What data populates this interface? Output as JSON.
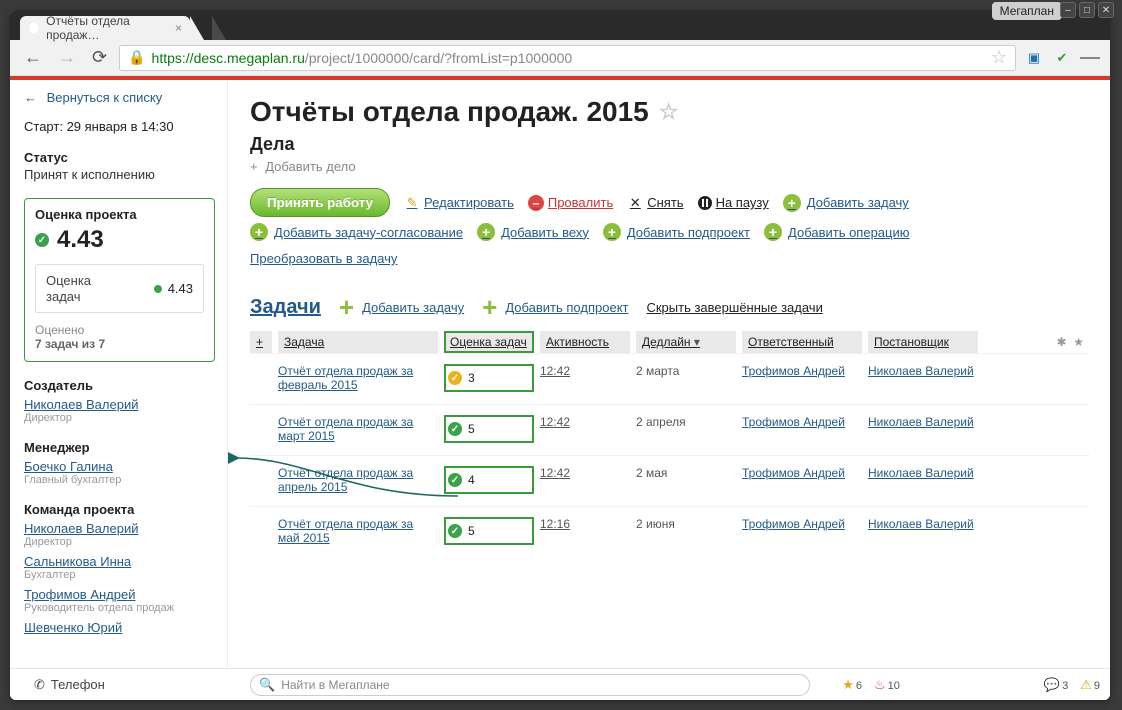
{
  "window": {
    "app": "Мегаплан",
    "tab_title": "Отчёты отдела продаж…"
  },
  "browser": {
    "url_proto": "https://",
    "url_host": "desc.megaplan.ru",
    "url_path": "/project/1000000/card/?fromList=p1000000"
  },
  "sidebar": {
    "back": "Вернуться к списку",
    "start_label": "Старт:",
    "start_value": "29 января в 14:30",
    "status_label": "Статус",
    "status_value": "Принят к исполнению",
    "rating": {
      "title": "Оценка проекта",
      "score": "4.43",
      "sub_label": "Оценка\nзадач",
      "sub_value": "4.43",
      "footer1": "Оценено",
      "footer2": "7 задач из 7"
    },
    "creator": {
      "hdr": "Создатель",
      "name": "Николаев Валерий",
      "role": "Директор"
    },
    "manager": {
      "hdr": "Менеджер",
      "name": "Боечко Галина",
      "role": "Главный бухгалтер"
    },
    "team_hdr": "Команда проекта",
    "team": [
      {
        "name": "Николаев Валерий",
        "role": "Директор"
      },
      {
        "name": "Сальникова Инна",
        "role": "Бухгалтер"
      },
      {
        "name": "Трофимов Андрей",
        "role": "Руководитель отдела продаж"
      },
      {
        "name": "Шевченко Юрий",
        "role": ""
      }
    ]
  },
  "page": {
    "title": "Отчёты отдела продаж. 2015",
    "section": "Дела",
    "add_deal": "Добавить дело"
  },
  "actions": {
    "accept": "Принять работу",
    "edit": "Редактировать",
    "fail": "Провалить",
    "remove": "Снять",
    "pause": "На паузу",
    "add_task": "Добавить задачу",
    "add_approval": "Добавить задачу-согласование",
    "add_milestone": "Добавить веху",
    "add_subproject": "Добавить подпроект",
    "add_operation": "Добавить операцию",
    "convert": "Преобразовать в задачу"
  },
  "tasks": {
    "heading": "Задачи",
    "add_task": "Добавить задачу",
    "add_subproject": "Добавить подпроект",
    "hide_done": "Скрыть завершённые задачи",
    "columns": {
      "expand": "+",
      "task": "Задача",
      "rating": "Оценка задач",
      "activity": "Активность",
      "deadline": "Дедлайн",
      "responsible": "Ответственный",
      "owner": "Постановщик"
    },
    "rows": [
      {
        "name": "Отчёт отдела продаж за февраль 2015",
        "rating_color": "yellow",
        "rating": "3",
        "activity": "12:42",
        "deadline": "2 марта",
        "responsible": "Трофимов Андрей",
        "owner": "Николаев Валерий"
      },
      {
        "name": "Отчёт отдела продаж за март 2015",
        "rating_color": "green",
        "rating": "5",
        "activity": "12:42",
        "deadline": "2 апреля",
        "responsible": "Трофимов Андрей",
        "owner": "Николаев Валерий"
      },
      {
        "name": "Отчёт отдела продаж за апрель 2015",
        "rating_color": "green",
        "rating": "4",
        "activity": "12:42",
        "deadline": "2 мая",
        "responsible": "Трофимов Андрей",
        "owner": "Николаев Валерий"
      },
      {
        "name": "Отчёт отдела продаж за май 2015",
        "rating_color": "green",
        "rating": "5",
        "activity": "12:16",
        "deadline": "2 июня",
        "responsible": "Трофимов Андрей",
        "owner": "Николаев Валерий"
      }
    ]
  },
  "bottom": {
    "phone": "Телефон",
    "search_placeholder": "Найти в Мегаплане",
    "star_count": "6",
    "fire_count": "10",
    "chat_count": "3",
    "warn_count": "9"
  }
}
